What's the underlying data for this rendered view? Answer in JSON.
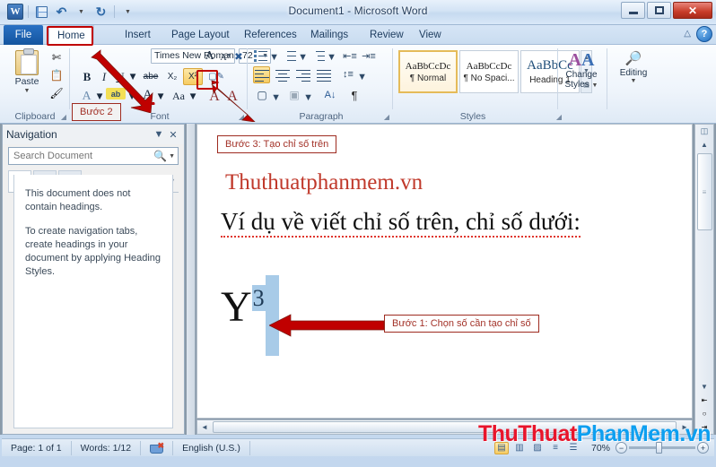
{
  "window": {
    "title": "Document1 - Microsoft Word",
    "app_logo": "word-logo",
    "quick_access": [
      {
        "name": "save-icon",
        "label": "Save"
      },
      {
        "name": "undo-icon",
        "label": "Undo"
      },
      {
        "name": "redo-icon",
        "label": "Redo"
      },
      {
        "name": "customize-qat-icon",
        "label": "Customize Quick Access Toolbar"
      }
    ],
    "controls": {
      "minimize": "—",
      "maximize": "❐",
      "close": "✕"
    }
  },
  "ribbon": {
    "tabs": [
      {
        "label": "File",
        "active": false,
        "special": true
      },
      {
        "label": "Home",
        "active": true
      },
      {
        "label": "Insert",
        "active": false
      },
      {
        "label": "Page Layout",
        "active": false
      },
      {
        "label": "References",
        "active": false
      },
      {
        "label": "Mailings",
        "active": false
      },
      {
        "label": "Review",
        "active": false
      },
      {
        "label": "View",
        "active": false
      }
    ],
    "collapse_icon": "chevron-up-icon",
    "help_icon": "help-icon",
    "help_label": "?",
    "groups": {
      "clipboard": {
        "label": "Clipboard",
        "paste_label": "Paste",
        "buttons": [
          "cut-icon",
          "copy-icon",
          "format-painter-icon"
        ]
      },
      "font": {
        "label": "Font",
        "font_name": "Times New Roman",
        "font_size": "72",
        "grow_font": "A",
        "shrink_font": "A",
        "clear_formatting": "clear-formatting-icon",
        "bold": "B",
        "italic": "I",
        "underline": "U",
        "strikethrough": "abe",
        "subscript": "X₂",
        "superscript": "X²",
        "superscript_active": true,
        "text_effects": "A",
        "highlight": "ab",
        "font_color": "A",
        "change_case": "Aa"
      },
      "paragraph": {
        "label": "Paragraph",
        "bullets": "bullets-icon",
        "numbering": "numbering-icon",
        "multilevel": "multilevel-list-icon",
        "decrease_indent": "decrease-indent-icon",
        "increase_indent": "increase-indent-icon",
        "align_left": "align-left-icon",
        "align_center": "align-center-icon",
        "align_right": "align-right-icon",
        "justify": "justify-icon",
        "line_spacing": "line-spacing-icon",
        "shading": "shading-icon",
        "borders": "borders-icon",
        "sort": "sort-icon",
        "show_marks": "¶",
        "active_alignment": "align_left"
      },
      "styles": {
        "label": "Styles",
        "items": [
          {
            "preview": "AaBbCcDc",
            "name": "¶ Normal",
            "selected": true
          },
          {
            "preview": "AaBbCcDc",
            "name": "¶ No Spaci...",
            "selected": false
          },
          {
            "preview": "AaBbCс",
            "name": "Heading 1",
            "selected": false
          }
        ],
        "change_styles": "Change\nStyles",
        "change_styles_line1": "Change",
        "change_styles_line2": "Styles"
      },
      "editing": {
        "label": "Editing",
        "icon": "find-binoculars-icon"
      }
    }
  },
  "navigation": {
    "title": "Navigation",
    "dropdown_icon": "chevron-down-icon",
    "close_icon": "close-icon",
    "search_placeholder": "Search Document",
    "search_value": "",
    "search_icon": "search-icon",
    "tabs": [
      {
        "name": "headings-tab",
        "icon": "headings-icon",
        "active": true
      },
      {
        "name": "pages-tab",
        "icon": "pages-thumbnail-icon",
        "active": false
      },
      {
        "name": "results-tab",
        "icon": "search-results-icon",
        "active": false
      }
    ],
    "prev_icon": "triangle-up-icon",
    "next_icon": "triangle-down-icon",
    "body_paragraph_1": "This document does not contain headings.",
    "body_paragraph_2": "To create navigation tabs, create headings in your document by applying Heading Styles."
  },
  "document": {
    "brand_line": "Thuthuatphanmem.vn",
    "body_line": "Ví dụ về viết chỉ số trên, chỉ số dưới:",
    "formula_base": "Y",
    "formula_superscript": "3",
    "horizontal_scroll": {
      "left_arrow": "◀",
      "right_arrow": "▶"
    },
    "vertical_scroll": {
      "up_arrow": "▲",
      "down_arrow": "▼",
      "prev_page": "⤒",
      "select_browse_object": "○",
      "next_page": "⤓",
      "split_icon": "split-bar-icon"
    }
  },
  "annotations": [
    {
      "id": "step2",
      "text": "Bước 2"
    },
    {
      "id": "step3",
      "text": "Bước 3: Tạo chỉ số trên"
    },
    {
      "id": "step1",
      "text": "Bước 1: Chọn số cần tạo chỉ số"
    }
  ],
  "statusbar": {
    "page": "Page: 1 of 1",
    "words": "Words: 1/12",
    "proofing_icon": "proofing-errors-icon",
    "language": "English (U.S.)",
    "views": [
      {
        "name": "print-layout-view",
        "icon": "▤",
        "active": true
      },
      {
        "name": "full-screen-reading-view",
        "icon": "▥",
        "active": false
      },
      {
        "name": "web-layout-view",
        "icon": "▨",
        "active": false
      },
      {
        "name": "outline-view",
        "icon": "≡",
        "active": false
      },
      {
        "name": "draft-view",
        "icon": "☰",
        "active": false
      }
    ],
    "zoom": "70%",
    "zoom_out": "−",
    "zoom_in": "+"
  },
  "watermark": {
    "part_red": "ThuThuat",
    "part_blue": "PhanMem.vn"
  },
  "colors": {
    "accent_red": "#c0392b",
    "annotation_red": "#9e2b20",
    "arrow_red": "#c00000",
    "highlight_gold": "#f6cc63",
    "selection_blue": "#a8cbe8",
    "watermark_red": "#e8152b",
    "watermark_blue": "#0d9ff0"
  }
}
